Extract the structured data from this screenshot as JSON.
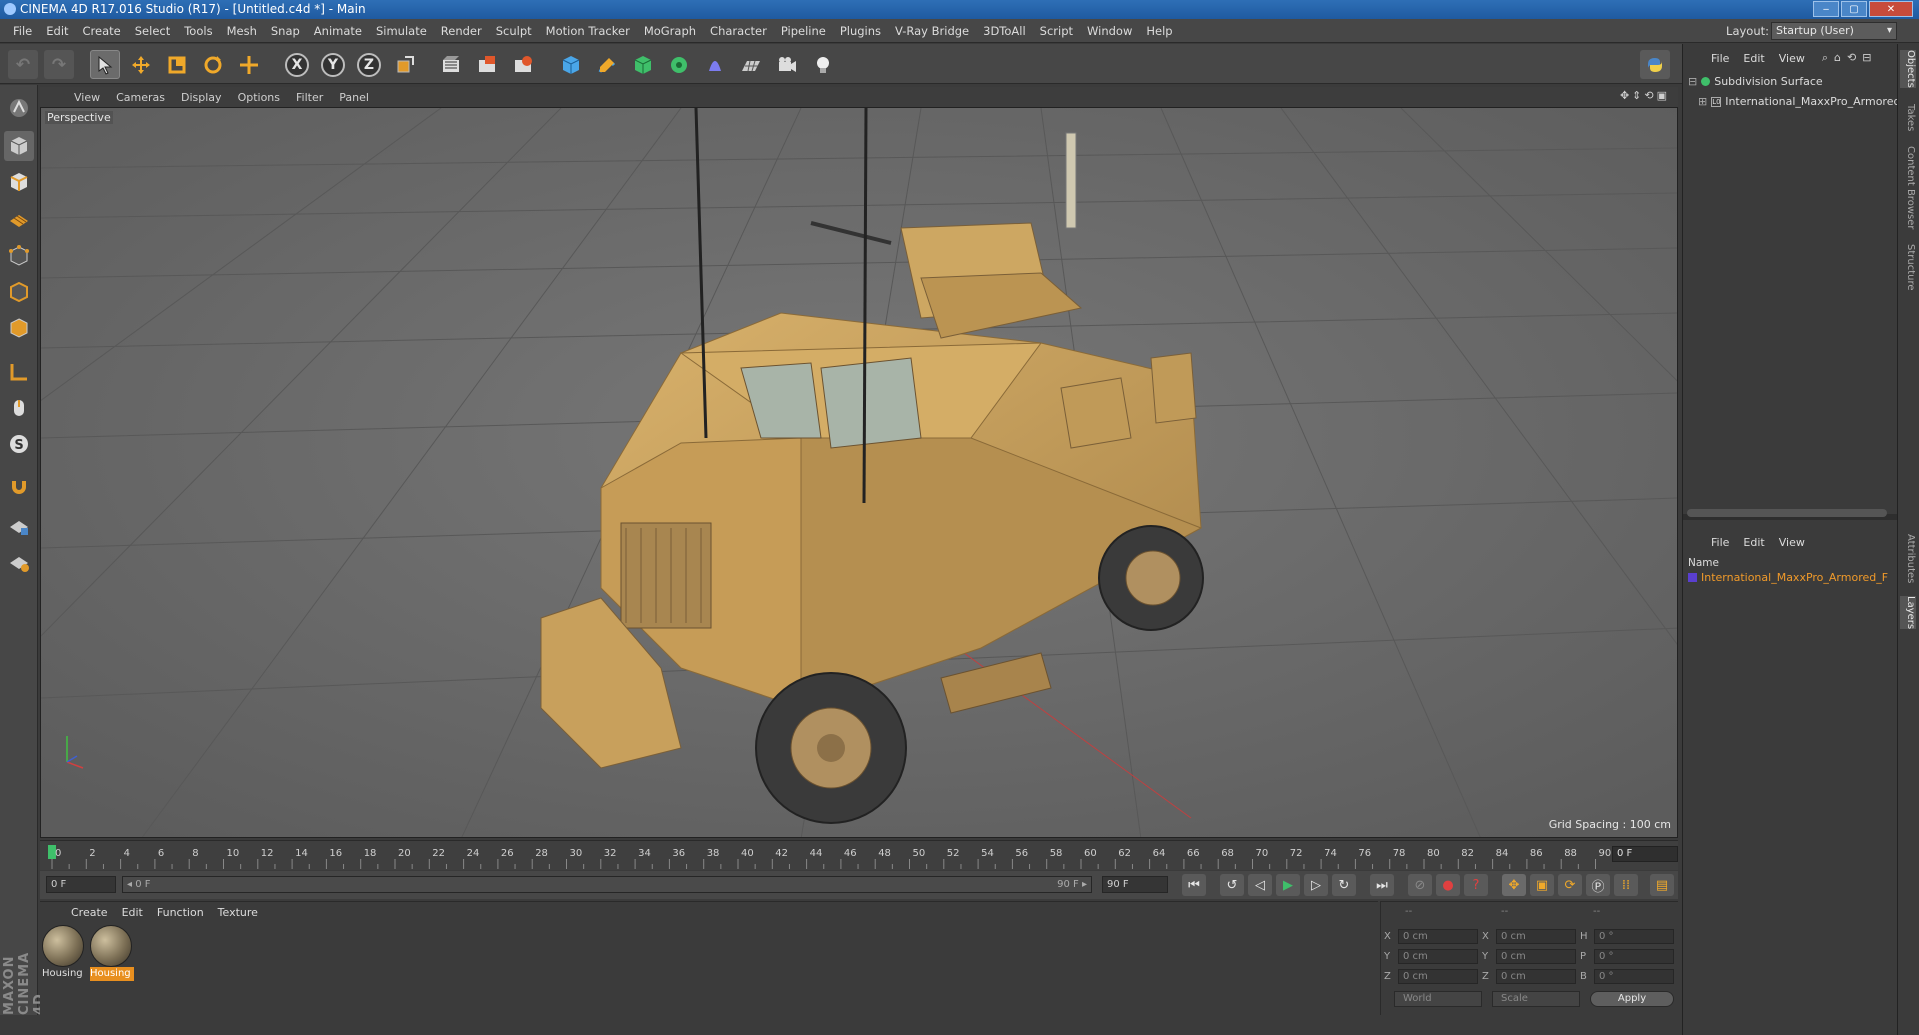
{
  "window": {
    "title": "CINEMA 4D R17.016 Studio (R17) - [Untitled.c4d *] - Main",
    "controls": [
      "‒",
      "▢",
      "✕"
    ]
  },
  "menubar": {
    "items": [
      "File",
      "Edit",
      "Create",
      "Select",
      "Tools",
      "Mesh",
      "Snap",
      "Animate",
      "Simulate",
      "Render",
      "Sculpt",
      "Motion Tracker",
      "MoGraph",
      "Character",
      "Pipeline",
      "Plugins",
      "V-Ray Bridge",
      "3DToAll",
      "Script",
      "Window",
      "Help"
    ],
    "layout_label": "Layout:",
    "layout_value": "Startup (User)"
  },
  "toolbar": {
    "axis": [
      "X",
      "Y",
      "Z"
    ]
  },
  "viewport": {
    "menu": [
      "View",
      "Cameras",
      "Display",
      "Options",
      "Filter",
      "Panel"
    ],
    "label": "Perspective",
    "grid_spacing": "Grid Spacing : 100 cm"
  },
  "timeline": {
    "ticks": [
      "0",
      "2",
      "4",
      "6",
      "8",
      "10",
      "12",
      "14",
      "16",
      "18",
      "20",
      "22",
      "24",
      "26",
      "28",
      "30",
      "32",
      "34",
      "36",
      "38",
      "40",
      "42",
      "44",
      "46",
      "48",
      "50",
      "52",
      "54",
      "56",
      "58",
      "60",
      "62",
      "64",
      "66",
      "68",
      "70",
      "72",
      "74",
      "76",
      "78",
      "80",
      "82",
      "84",
      "86",
      "88",
      "90"
    ],
    "current_frame": "0 F",
    "start_field": "0 F",
    "range_start": "◂ 0 F",
    "range_end": "90 F ▸",
    "end_field": "90 F"
  },
  "material_manager": {
    "menu": [
      "Create",
      "Edit",
      "Function",
      "Texture"
    ],
    "materials": [
      {
        "name": "Housing",
        "selected": false
      },
      {
        "name": "Housing",
        "selected": true
      }
    ]
  },
  "coordinates": {
    "header": [
      "--",
      "--",
      "--"
    ],
    "rows": [
      {
        "a": "X",
        "av": "0 cm",
        "b": "X",
        "bv": "0 cm",
        "c": "H",
        "cv": "0 °"
      },
      {
        "a": "Y",
        "av": "0 cm",
        "b": "Y",
        "bv": "0 cm",
        "c": "P",
        "cv": "0 °"
      },
      {
        "a": "Z",
        "av": "0 cm",
        "b": "Z",
        "bv": "0 cm",
        "c": "B",
        "cv": "0 °"
      }
    ],
    "mode1": "World",
    "mode2": "Scale",
    "apply": "Apply"
  },
  "object_manager": {
    "menu": [
      "File",
      "Edit",
      "View"
    ],
    "items": [
      {
        "label": "Subdivision Surface"
      },
      {
        "label": "International_MaxxPro_Armored_"
      }
    ]
  },
  "layer_manager": {
    "menu": [
      "File",
      "Edit",
      "View"
    ],
    "column": "Name",
    "row": "International_MaxxPro_Armored_F"
  },
  "side_tabs": [
    "Objects",
    "Takes",
    "Content Browser",
    "Structure",
    "Attributes",
    "Layers"
  ],
  "brand": "MAXON CINEMA 4D",
  "colors": {
    "accent": "#e88f1f",
    "layer_text": "#f09a2a",
    "vehicle": "#c9a15a"
  }
}
